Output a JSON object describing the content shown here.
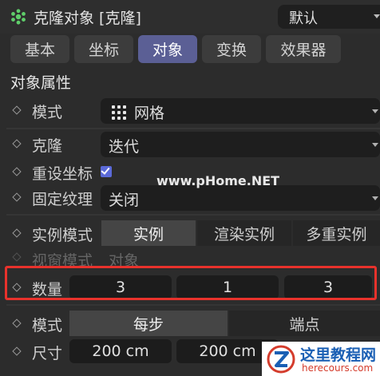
{
  "header": {
    "title": "克隆对象 [克隆]",
    "preset": "默认"
  },
  "tabs": [
    {
      "label": "基本"
    },
    {
      "label": "坐标"
    },
    {
      "label": "对象"
    },
    {
      "label": "变换"
    },
    {
      "label": "效果器"
    }
  ],
  "active_tab": "对象",
  "section_title": "对象属性",
  "props": {
    "mode": {
      "label": "模式",
      "value": "网格"
    },
    "clone": {
      "label": "克隆",
      "value": "迭代"
    },
    "reset_coords": {
      "label": "重设坐标",
      "checked": true
    },
    "fixed_texture": {
      "label": "固定纹理",
      "value": "关闭"
    },
    "instance_mode": {
      "label": "实例模式",
      "options": [
        "实例",
        "渲染实例",
        "多重实例"
      ],
      "selected": "实例"
    },
    "viewport_mode": {
      "label": "视窗模式",
      "value": "对象"
    },
    "count": {
      "label": "数量",
      "values": [
        "3",
        "1",
        "3"
      ]
    },
    "mode2": {
      "label": "模式",
      "options": [
        "每步",
        "端点"
      ],
      "selected": "每步"
    },
    "size": {
      "label": "尺寸",
      "values": [
        "200 cm",
        "200 cm"
      ]
    }
  },
  "watermark": "www.pHome.NET",
  "logo": {
    "name": "这里教程网",
    "url": "herecours.com"
  },
  "colors": {
    "accent_tab": "#5b5f95",
    "highlight": "#e8322c",
    "checkbox": "#5b6ad8"
  }
}
